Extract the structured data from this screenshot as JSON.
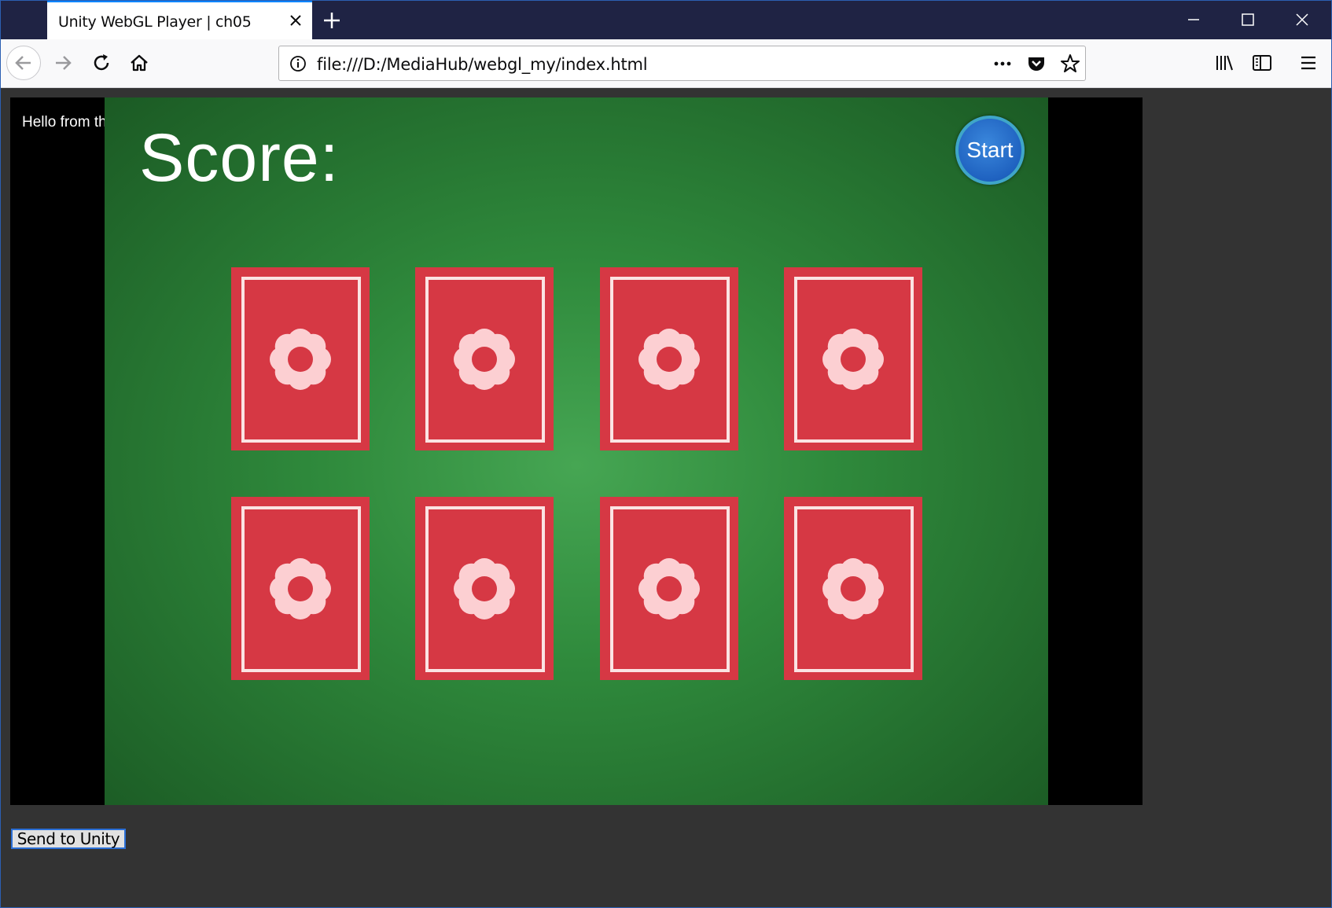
{
  "browser": {
    "tab_title": "Unity WebGL Player | ch05",
    "url": "file:///D:/MediaHub/webgl_my/index.html"
  },
  "game": {
    "browser_message": "Hello from the browser!",
    "score_label": "Score:",
    "start_label": "Start",
    "cards": [
      {
        "id": 1,
        "state": "face-down"
      },
      {
        "id": 2,
        "state": "face-down"
      },
      {
        "id": 3,
        "state": "face-down"
      },
      {
        "id": 4,
        "state": "face-down"
      },
      {
        "id": 5,
        "state": "face-down"
      },
      {
        "id": 6,
        "state": "face-down"
      },
      {
        "id": 7,
        "state": "face-down"
      },
      {
        "id": 8,
        "state": "face-down"
      }
    ]
  },
  "page": {
    "send_button_label": "Send to Unity"
  },
  "colors": {
    "table_green": "#2f8a3c",
    "card_red": "#d63844",
    "card_accent": "#fbe3e3",
    "start_blue": "#1f62c0"
  },
  "icons": [
    "close-icon",
    "plus-icon",
    "minimize-icon",
    "maximize-icon",
    "back-arrow-icon",
    "forward-arrow-icon",
    "reload-icon",
    "home-icon",
    "info-icon",
    "more-icon",
    "pocket-icon",
    "star-icon",
    "library-icon",
    "sidebar-icon",
    "menu-icon",
    "flower-icon"
  ]
}
